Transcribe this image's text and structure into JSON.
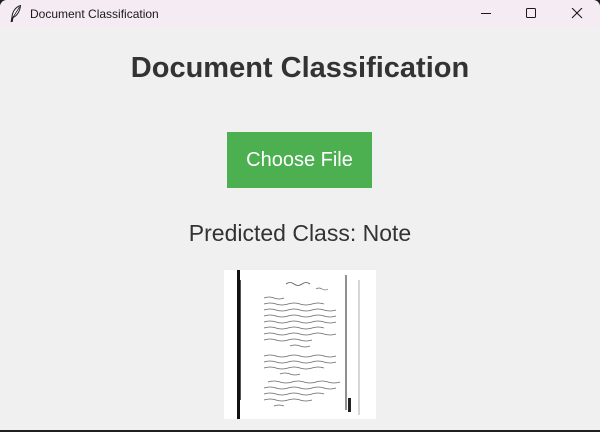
{
  "window": {
    "title": "Document Classification",
    "app_icon": "feather-icon",
    "controls": [
      "minimize-icon",
      "maximize-icon",
      "close-icon"
    ]
  },
  "main": {
    "heading": "Document Classification",
    "choose_button_label": "Choose File",
    "prediction_text": "Predicted Class: Note",
    "preview_image": "scanned handwritten note document thumbnail"
  },
  "colors": {
    "titlebar": "#f5ebf3",
    "background": "#f0f0f0",
    "button": "#4caf50",
    "button_text": "#ffffff",
    "text": "#333333"
  }
}
